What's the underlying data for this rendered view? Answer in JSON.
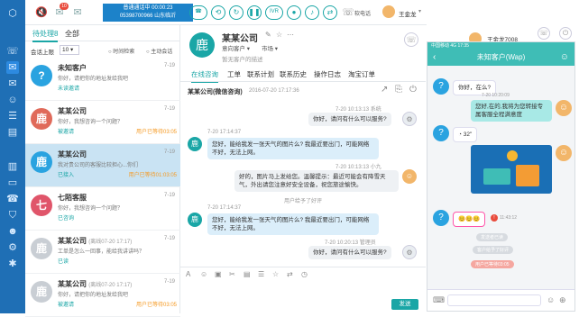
{
  "top": {
    "status_line1": "普通通话中 00:00:23",
    "status_line2": "05398700966 山东临沂",
    "ivr_label": "IVR",
    "phone_btn_label": "软电话",
    "agent_name": "王金龙",
    "badge_count": "10",
    "buttons": [
      "hangup",
      "hold",
      "transfer",
      "pause",
      "ivr",
      "record",
      "mute",
      "consult"
    ]
  },
  "list": {
    "tab_pending": "待处理8",
    "tab_all": "全部",
    "session_sort_label": "会话上限",
    "session_limit": "10",
    "sort_time": "时间检索",
    "sort_active": "主动会话",
    "conversations": [
      {
        "name": "未知客户",
        "time": "7-19",
        "msg": "你好，请把你的地址发给我吧",
        "tag": "未读邀请",
        "wait": "",
        "avatar": "?",
        "color": "#2aa3e0"
      },
      {
        "name": "某某公司",
        "time": "7-19",
        "msg": "你好，我想咨询一个问题？",
        "tag": "被邀请",
        "wait": "用户已等待03:05",
        "avatar": "鹿",
        "color": "#e06a5a"
      },
      {
        "name": "某某公司",
        "time": "7-19",
        "msg": "我对贵公司的客服比较担心...你们",
        "tag": "已接入",
        "wait": "用户已等待01:03:05",
        "avatar": "鹿",
        "color": "#2aa3e0"
      },
      {
        "name": "七陌客服",
        "time": "7-19",
        "msg": "你好，我想咨询一个问题？",
        "tag": "已咨询",
        "wait": "",
        "avatar": "七",
        "color": "#e0556a"
      },
      {
        "name": "某某公司",
        "sub": "(离线07-20 17:17)",
        "time": "7-19",
        "msg": "工单是怎么一回事，能给我讲讲吗？",
        "tag": "已读",
        "wait": "",
        "avatar": "鹿",
        "color": "#c9ced4"
      },
      {
        "name": "某某公司",
        "sub": "(离线07-20 17:17)",
        "time": "7-19",
        "msg": "你好，请把你的地址发给我吧",
        "tag": "被邀请",
        "wait": "用户已等待03:05",
        "avatar": "鹿",
        "color": "#c9ced4"
      }
    ]
  },
  "chat": {
    "company": "某某公司",
    "sub1": "意向客户",
    "sub2": "市场",
    "desc": "暂无客户的描述",
    "tabs": [
      "在线咨询",
      "工单",
      "联系计划",
      "联系历史",
      "操作日志",
      "淘宝订单"
    ],
    "session_title": "某某公司(微信咨询)",
    "session_time": "2016-07-20 17:17:36",
    "messages": [
      {
        "side": "r",
        "meta": "7-20 10:13:13 系统",
        "text": "你好，请问有什么可以服务?"
      },
      {
        "side": "l",
        "meta": "7-20 17:14:37",
        "text": "您好，能给我发一张天气的图片么? 我最近要出门，可能网络不好，无法上网。"
      },
      {
        "side": "p",
        "meta": "7-20 10:13:13 小九",
        "text": "好的，图片马上发给您。温馨提示：最近可能会有降雪天气，外出请您注意好安全设备，祝您旅途愉快。"
      },
      {
        "side": "c",
        "text": "用户给予了好评"
      },
      {
        "side": "l",
        "meta": "7-20 17:14:37",
        "text": "您好，能给我发一张天气的图片么? 我最近要出门，可能网络不好，无法上网。"
      },
      {
        "side": "r",
        "meta": "7-20 10:20:13 管理员",
        "text": "你好，请问有什么可以服务?"
      }
    ],
    "send_label": "发送"
  },
  "phone": {
    "status": "中国移动  4G  17:35",
    "title": "未知客户(Wap)",
    "agent_label": "王金龙7008",
    "messages": [
      {
        "side": "l",
        "text": "你好，在么?"
      },
      {
        "side": "r",
        "meta": "7-20 10:20:09",
        "text": "您好,在的,我将为您转接专属客服全程满意度"
      },
      {
        "side": "l",
        "text": "32\""
      },
      {
        "side": "img",
        "text": ""
      },
      {
        "side": "emo",
        "time": "11:43:12",
        "text": "😊😊😊"
      },
      {
        "side": "pill",
        "text": "发送者已读"
      },
      {
        "side": "pill",
        "text": "客户给予了好评"
      },
      {
        "side": "pill",
        "text": "用户已等待03:05"
      }
    ]
  }
}
